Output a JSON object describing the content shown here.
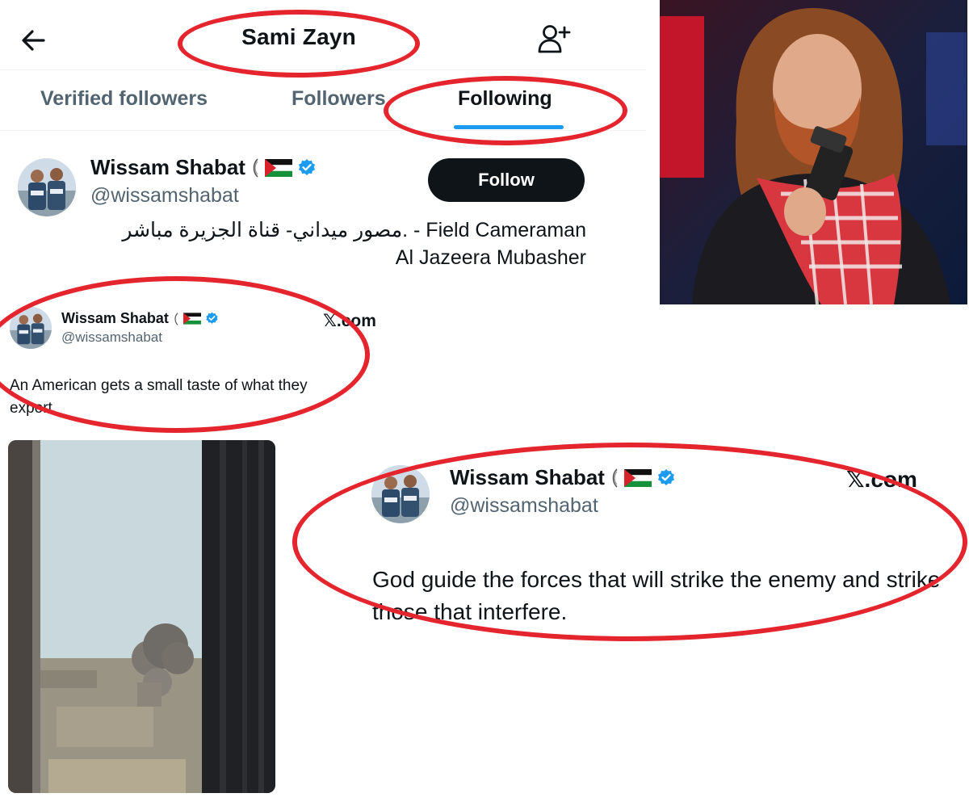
{
  "header": {
    "title": "Sami Zayn",
    "back_icon": "arrow-left-icon",
    "add_icon": "add-user-icon"
  },
  "tabs": [
    {
      "label": "Verified followers",
      "active": false
    },
    {
      "label": "Followers",
      "active": false
    },
    {
      "label": "Following",
      "active": true
    }
  ],
  "profile": {
    "name": "Wissam Shabat",
    "handle": "@wissamshabat",
    "follow_label": "Follow",
    "bio_line1": "مصور ميداني- قناة الجزيرة مباشر. - Field Cameraman",
    "bio_line2": "Al Jazeera Mubasher"
  },
  "embeds": [
    {
      "name": "Wissam Shabat",
      "handle": "@wissamshabat",
      "source": "𝕏.com",
      "text": "An American gets a small taste of what they export."
    },
    {
      "name": "Wissam Shabat",
      "handle": "@wissamshabat",
      "source": "𝕏.com",
      "text": "God guide the forces that will strike the enemy and strike those that interfere."
    }
  ],
  "colors": {
    "accent": "#1d9bf0",
    "annotation": "#e5252d",
    "text_primary": "#0f1419",
    "text_secondary": "#536471"
  }
}
